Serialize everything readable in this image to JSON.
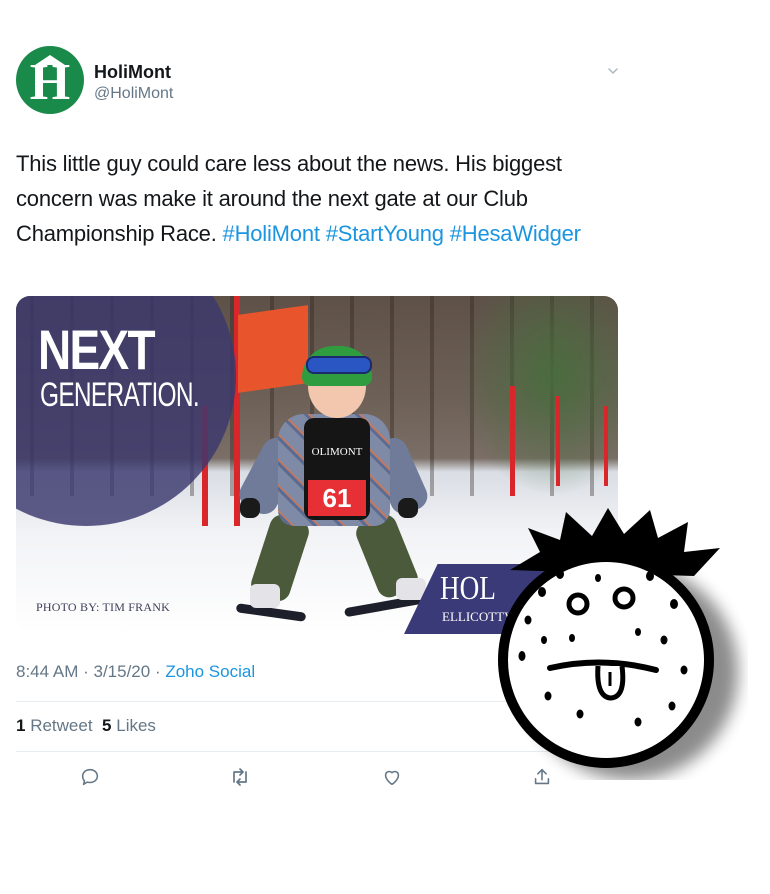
{
  "account": {
    "display_name": "HoliMont",
    "handle": "@HoliMont",
    "avatar_letter": "H",
    "avatar_color": "#1a8a4a"
  },
  "tweet": {
    "text_plain": "This little guy could care less about the news. His biggest concern was make it around the next gate at our Club Championship Race. ",
    "hashtags": [
      "#HoliMont",
      "#StartYoung",
      "#HesaWidger"
    ],
    "hashtag_color": "#1b95e0"
  },
  "media": {
    "overlay_line1": "NEXT",
    "overlay_line2": "GENERATION.",
    "photo_credit": "PHOTO BY: TIM FRANK",
    "brand_partial": "HOL",
    "brand_sub_partial": "ELLICOTTV",
    "bib_brand": "OLIMONT",
    "bib_number": "61"
  },
  "meta": {
    "time": "8:44 AM",
    "date": "3/15/20",
    "separator": " · ",
    "source": "Zoho Social"
  },
  "stats": {
    "retweets_count": "1",
    "retweets_label": "Retweet",
    "likes_count": "5",
    "likes_label": "Likes"
  },
  "icons": {
    "caret": "chevron-down-icon",
    "reply": "reply-icon",
    "retweet": "retweet-icon",
    "like": "heart-icon",
    "share": "share-icon"
  },
  "colors": {
    "muted_text": "#657786",
    "link": "#1b95e0",
    "primary_text": "#14171a"
  }
}
